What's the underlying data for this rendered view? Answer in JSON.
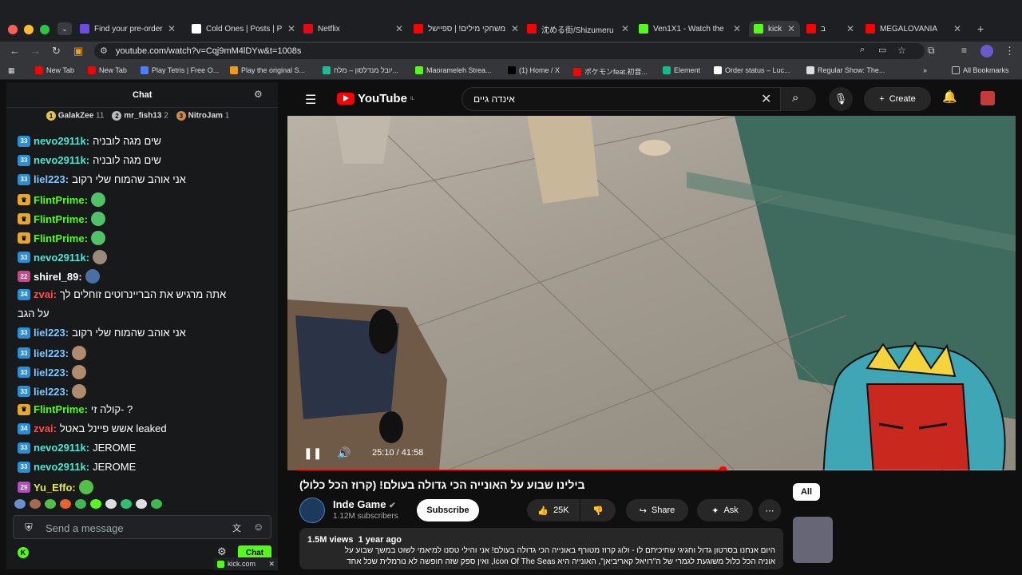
{
  "browser": {
    "tabs": [
      {
        "label": "Find your pre-order",
        "color": "#6b4de6"
      },
      {
        "label": "Cold Ones | Posts | P",
        "color": "#ffffff"
      },
      {
        "label": "Netflix",
        "color": "#e50914"
      },
      {
        "label": "משחקי מילים! | ספיישל",
        "color": "#ff0000"
      },
      {
        "label": "沈める街/Shizumeru",
        "color": "#ff0000"
      },
      {
        "label": "Ven1X1 - Watch the",
        "color": "#53fc18"
      },
      {
        "label": "kick",
        "color": "#53fc18"
      },
      {
        "label": "ב",
        "color": "#ff0000"
      },
      {
        "label": "MEGALOVANIA",
        "color": "#ff0000"
      }
    ],
    "url": "youtube.com/watch?v=Cqj9mM4lDYw&t=1008s",
    "bookmarks": [
      {
        "label": "New Tab",
        "color": "#ff0000"
      },
      {
        "label": "New Tab",
        "color": "#ff0000"
      },
      {
        "label": "Play Tetris | Free O...",
        "color": "#4a7dff"
      },
      {
        "label": "Play the original S...",
        "color": "#f39c12"
      },
      {
        "label": "יובל מנדלסון – מלח...",
        "color": "#1abc9c"
      },
      {
        "label": "Maorameleh Strea...",
        "color": "#53fc18"
      },
      {
        "label": "(1) Home / X",
        "color": "#000000"
      },
      {
        "label": "ポケモンfeat.初音...",
        "color": "#ff0000"
      },
      {
        "label": "Element",
        "color": "#0dbd8b"
      },
      {
        "label": "Order status – Luc...",
        "color": "#ffffff"
      },
      {
        "label": "Regular Show: The...",
        "color": "#dddddd"
      }
    ],
    "all_bookmarks": "All Bookmarks",
    "bottom_tab": "kick.com"
  },
  "chat": {
    "title": "Chat",
    "gifters": [
      {
        "rank": "1",
        "name": "GalakZee",
        "count": "11"
      },
      {
        "rank": "2",
        "name": "mr_fish13",
        "count": "2"
      },
      {
        "rank": "3",
        "name": "NitroJam",
        "count": "1"
      }
    ],
    "messages": [
      {
        "badge": "33",
        "user": "nevo2911k:",
        "color": "#4ee6d3",
        "text": "שים מגה לובניה"
      },
      {
        "badge": "33",
        "user": "nevo2911k:",
        "color": "#4ee6d3",
        "text": "שים מגה לובניה"
      },
      {
        "badge": "33",
        "user": "liel223:",
        "color": "#7ec8ff",
        "text": "אני אוהב שהמוח שלי רקוב"
      },
      {
        "badge": "crown",
        "user": "FlintPrime:",
        "color": "#53fc18",
        "text": ""
      },
      {
        "badge": "crown",
        "user": "FlintPrime:",
        "color": "#53fc18",
        "text": ""
      },
      {
        "badge": "crown",
        "user": "FlintPrime:",
        "color": "#53fc18",
        "text": ""
      },
      {
        "badge": "33",
        "user": "nevo2911k:",
        "color": "#4ee6d3",
        "text": ""
      },
      {
        "badge": "22",
        "user": "shirel_89:",
        "color": "#ffffff",
        "text": ""
      },
      {
        "badge": "34",
        "user": "zvai:",
        "color": "#ff4d4d",
        "text": "אתה מרגיש את הבריינרוטים זוחלים לך"
      },
      {
        "badge": "",
        "user": "",
        "color": "#ffffff",
        "text": "על הגב"
      },
      {
        "badge": "33",
        "user": "liel223:",
        "color": "#7ec8ff",
        "text": "אני אוהב שהמוח שלי רקוב"
      },
      {
        "badge": "33",
        "user": "liel223:",
        "color": "#7ec8ff",
        "text": ""
      },
      {
        "badge": "33",
        "user": "liel223:",
        "color": "#7ec8ff",
        "text": ""
      },
      {
        "badge": "33",
        "user": "liel223:",
        "color": "#7ec8ff",
        "text": ""
      },
      {
        "badge": "crown",
        "user": "FlintPrime:",
        "color": "#53fc18",
        "text": "קולה זי- ?"
      },
      {
        "badge": "34",
        "user": "zvai:",
        "color": "#ff4d4d",
        "text": "אשש פיינל באטל leaked"
      },
      {
        "badge": "33",
        "user": "nevo2911k:",
        "color": "#4ee6d3",
        "text": "JEROME"
      },
      {
        "badge": "33",
        "user": "nevo2911k:",
        "color": "#4ee6d3",
        "text": "JEROME"
      },
      {
        "badge": "29",
        "user": "Yu_Effo:",
        "color": "#e6e64e",
        "text": ""
      }
    ],
    "input_placeholder": "Send a message",
    "send_label": "Chat"
  },
  "youtube": {
    "logo": "YouTube",
    "logo_region": "IL",
    "search_value": "אינדה גיים",
    "create_label": "Create",
    "time_current": "25:10",
    "time_total": "41:58",
    "progress": 0.6,
    "video_title": "בילינו שבוע על האונייה הכי גדולה בעולם! (קרוז הכל כלול)",
    "channel_name": "Inde Game",
    "subscribers": "1.12M subscribers",
    "subscribe_label": "Subscribe",
    "likes": "25K",
    "share_label": "Share",
    "ask_label": "Ask",
    "views": "1.5M views",
    "age": "1 year ago",
    "desc_line1": "היום אנחנו בסרטון גדול וחגיגי שחיכיתם לו - ולוג קרוז מטורף באונייה הכי גדולה בעולם! אני והילי טסנו למיאמי לשוט במשך שבוע על",
    "desc_line2": "אוניה הכל כלול משוגעת לגמרי של ה\"רויאל קאריביאן\", האונייה היא Icon Of The Seas, ואין ספק שזה חופשה לא נורמלית שכל אחד",
    "filter_all": "All"
  }
}
